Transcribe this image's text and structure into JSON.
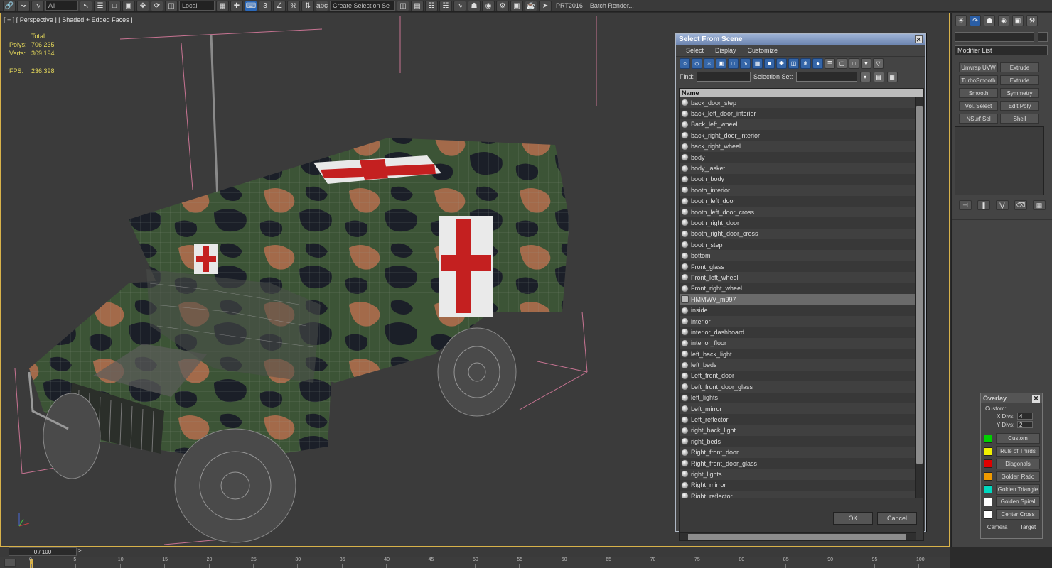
{
  "toolbar": {
    "dropdown_view": "All",
    "dropdown_ref": "Local",
    "selection_set_placeholder": "Create Selection Se",
    "prt_label": "PRT2016",
    "batch_render": "Batch Render..."
  },
  "viewport": {
    "label": "[ + ] [ Perspective ] [ Shaded + Edged Faces ]",
    "stats": {
      "total_label": "Total",
      "polys_label": "Polys:",
      "polys_value": "706 235",
      "verts_label": "Verts:",
      "verts_value": "369 194",
      "fps_label": "FPS:",
      "fps_value": "236,398"
    }
  },
  "select_from_scene": {
    "title": "Select From Scene",
    "menu": [
      "Select",
      "Display",
      "Customize"
    ],
    "find_label": "Find:",
    "selection_set_label": "Selection Set:",
    "column_name": "Name",
    "items": [
      "back_door_step",
      "back_left_door_interior",
      "Back_left_wheel",
      "back_right_door_interior",
      "back_right_wheel",
      "body",
      "body_jasket",
      "booth_body",
      "booth_interior",
      "booth_left_door",
      "booth_left_door_cross",
      "booth_right_door",
      "booth_right_door_cross",
      "booth_step",
      "bottom",
      "Front_glass",
      "Front_left_wheel",
      "Front_right_wheel",
      "HMMWV_m997",
      "inside",
      "interior",
      "interior_dashboard",
      "interior_floor",
      "left_back_light",
      "left_beds",
      "Left_front_door",
      "Left_front_door_glass",
      "left_lights",
      "Left_mirror",
      "Left_reflector",
      "right_back_light",
      "right_beds",
      "Right_front_door",
      "Right_front_door_glass",
      "right_lights",
      "Right_mirror",
      "Right_reflector"
    ],
    "selected_item": "HMMWV_m997",
    "ok_label": "OK",
    "cancel_label": "Cancel"
  },
  "command_panel": {
    "modifier_list": "Modifier List",
    "modifiers": [
      "Unwrap UVW",
      "Extrude",
      "TurboSmooth",
      "Extrude",
      "Smooth",
      "Symmetry",
      "Vol. Select",
      "Edit Poly",
      "NSurf Sel",
      "Shell"
    ]
  },
  "overlay": {
    "title": "Overlay",
    "custom_label": "Custom:",
    "x_divs_label": "X Divs:",
    "x_divs_value": "4",
    "y_divs_label": "Y Divs:",
    "y_divs_value": "2",
    "items": [
      {
        "label": "Custom",
        "color": "#00d000"
      },
      {
        "label": "Rule of Thirds",
        "color": "#f0f000"
      },
      {
        "label": "Diagonals",
        "color": "#e00000"
      },
      {
        "label": "Golden Ratio",
        "color": "#f09a00"
      },
      {
        "label": "Golden Triangle",
        "color": "#00d8c0"
      },
      {
        "label": "Golden Spiral",
        "color": "#ffffff"
      },
      {
        "label": "Center Cross",
        "color": "#ffffff"
      }
    ],
    "camera_label": "Camera",
    "target_label": "Target"
  },
  "timeline": {
    "frame_label": "0 / 100",
    "next_label": ">",
    "ticks": [
      "0",
      "5",
      "10",
      "15",
      "20",
      "25",
      "30",
      "35",
      "40",
      "45",
      "50",
      "55",
      "60",
      "65",
      "70",
      "75",
      "80",
      "85",
      "90",
      "95",
      "100"
    ]
  },
  "colors": {
    "viewport_border": "#d8b24a",
    "stats_text": "#e6d95a",
    "title_bar": "#6d85b0",
    "selected_row": "#6a6a6a"
  }
}
